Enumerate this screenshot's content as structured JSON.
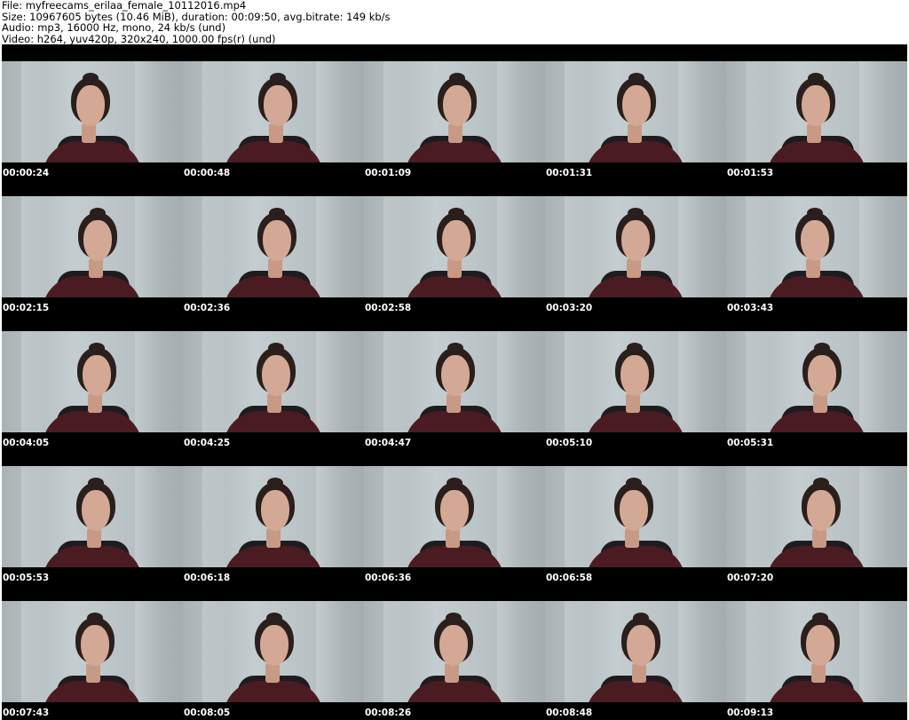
{
  "header": {
    "file": "File: myfreecams_erilaa_female_10112016.mp4",
    "size": "Size: 10967605 bytes (10.46 MiB), duration: 00:09:50, avg.bitrate: 149 kb/s",
    "audio": "Audio: mp3, 16000 Hz, mono, 24 kb/s (und)",
    "video": "Video: h264, yuv420p, 320x240, 1000.00 fps(r) (und)"
  },
  "colors": {
    "sheet_background": "#000000",
    "timestamp_text": "#ffffff",
    "header_text": "#000000"
  },
  "thumbnails": [
    {
      "time": "00:00:24"
    },
    {
      "time": "00:00:48"
    },
    {
      "time": "00:01:09"
    },
    {
      "time": "00:01:31"
    },
    {
      "time": "00:01:53"
    },
    {
      "time": "00:02:15"
    },
    {
      "time": "00:02:36"
    },
    {
      "time": "00:02:58"
    },
    {
      "time": "00:03:20"
    },
    {
      "time": "00:03:43"
    },
    {
      "time": "00:04:05"
    },
    {
      "time": "00:04:25"
    },
    {
      "time": "00:04:47"
    },
    {
      "time": "00:05:10"
    },
    {
      "time": "00:05:31"
    },
    {
      "time": "00:05:53"
    },
    {
      "time": "00:06:18"
    },
    {
      "time": "00:06:36"
    },
    {
      "time": "00:06:58"
    },
    {
      "time": "00:07:20"
    },
    {
      "time": "00:07:43"
    },
    {
      "time": "00:08:05"
    },
    {
      "time": "00:08:26"
    },
    {
      "time": "00:08:48"
    },
    {
      "time": "00:09:13"
    }
  ]
}
